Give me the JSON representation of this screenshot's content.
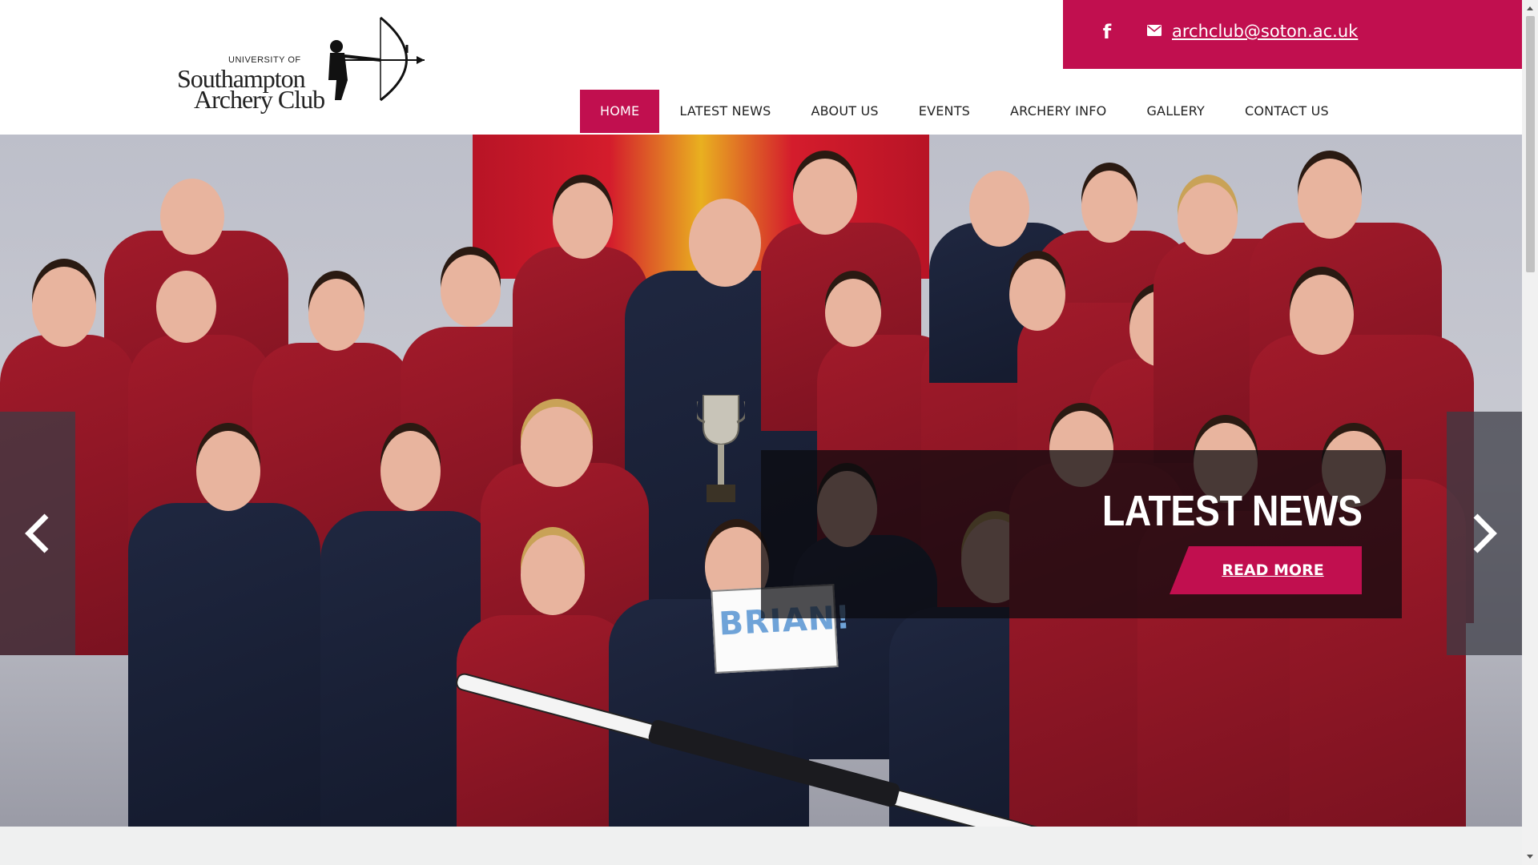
{
  "logo": {
    "line_university": "UNIVERSITY OF",
    "line_1": "Southampton",
    "line_2": "Archery Club"
  },
  "topbar": {
    "facebook_icon": "facebook-icon",
    "mail_icon": "envelope-icon",
    "email": "archclub@soton.ac.uk",
    "background_color": "#c10f4f"
  },
  "nav": {
    "items": [
      {
        "label": "HOME",
        "active": true
      },
      {
        "label": "LATEST NEWS"
      },
      {
        "label": "ABOUT US"
      },
      {
        "label": "EVENTS"
      },
      {
        "label": "ARCHERY INFO"
      },
      {
        "label": "GALLERY"
      },
      {
        "label": "CONTACT US"
      }
    ],
    "active_color": "#c10f4f"
  },
  "hero": {
    "sign_text": "BRIAN!",
    "caption_title": "LATEST NEWS",
    "caption_button": "READ MORE",
    "prev_icon": "chevron-left-icon",
    "next_icon": "chevron-right-icon"
  }
}
